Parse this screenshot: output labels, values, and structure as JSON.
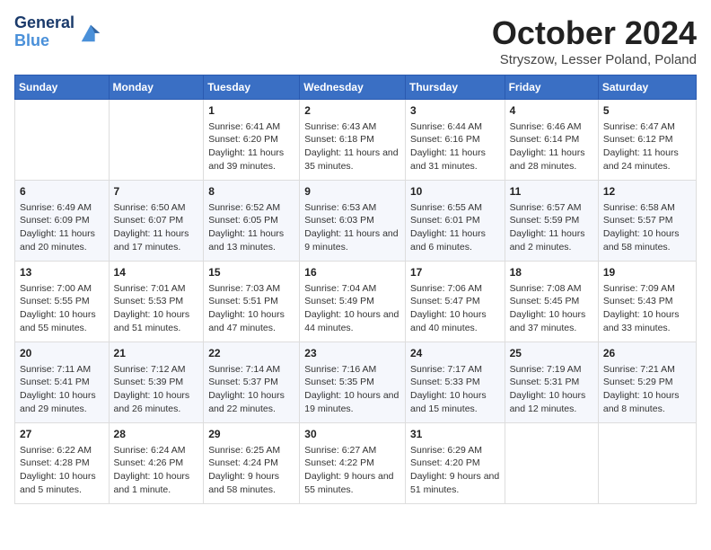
{
  "header": {
    "logo_line1": "General",
    "logo_line2": "Blue",
    "month_title": "October 2024",
    "location": "Stryszow, Lesser Poland, Poland"
  },
  "days_of_week": [
    "Sunday",
    "Monday",
    "Tuesday",
    "Wednesday",
    "Thursday",
    "Friday",
    "Saturday"
  ],
  "weeks": [
    [
      {
        "day": null,
        "info": null
      },
      {
        "day": null,
        "info": null
      },
      {
        "day": "1",
        "info": "Sunrise: 6:41 AM\nSunset: 6:20 PM\nDaylight: 11 hours and 39 minutes."
      },
      {
        "day": "2",
        "info": "Sunrise: 6:43 AM\nSunset: 6:18 PM\nDaylight: 11 hours and 35 minutes."
      },
      {
        "day": "3",
        "info": "Sunrise: 6:44 AM\nSunset: 6:16 PM\nDaylight: 11 hours and 31 minutes."
      },
      {
        "day": "4",
        "info": "Sunrise: 6:46 AM\nSunset: 6:14 PM\nDaylight: 11 hours and 28 minutes."
      },
      {
        "day": "5",
        "info": "Sunrise: 6:47 AM\nSunset: 6:12 PM\nDaylight: 11 hours and 24 minutes."
      }
    ],
    [
      {
        "day": "6",
        "info": "Sunrise: 6:49 AM\nSunset: 6:09 PM\nDaylight: 11 hours and 20 minutes."
      },
      {
        "day": "7",
        "info": "Sunrise: 6:50 AM\nSunset: 6:07 PM\nDaylight: 11 hours and 17 minutes."
      },
      {
        "day": "8",
        "info": "Sunrise: 6:52 AM\nSunset: 6:05 PM\nDaylight: 11 hours and 13 minutes."
      },
      {
        "day": "9",
        "info": "Sunrise: 6:53 AM\nSunset: 6:03 PM\nDaylight: 11 hours and 9 minutes."
      },
      {
        "day": "10",
        "info": "Sunrise: 6:55 AM\nSunset: 6:01 PM\nDaylight: 11 hours and 6 minutes."
      },
      {
        "day": "11",
        "info": "Sunrise: 6:57 AM\nSunset: 5:59 PM\nDaylight: 11 hours and 2 minutes."
      },
      {
        "day": "12",
        "info": "Sunrise: 6:58 AM\nSunset: 5:57 PM\nDaylight: 10 hours and 58 minutes."
      }
    ],
    [
      {
        "day": "13",
        "info": "Sunrise: 7:00 AM\nSunset: 5:55 PM\nDaylight: 10 hours and 55 minutes."
      },
      {
        "day": "14",
        "info": "Sunrise: 7:01 AM\nSunset: 5:53 PM\nDaylight: 10 hours and 51 minutes."
      },
      {
        "day": "15",
        "info": "Sunrise: 7:03 AM\nSunset: 5:51 PM\nDaylight: 10 hours and 47 minutes."
      },
      {
        "day": "16",
        "info": "Sunrise: 7:04 AM\nSunset: 5:49 PM\nDaylight: 10 hours and 44 minutes."
      },
      {
        "day": "17",
        "info": "Sunrise: 7:06 AM\nSunset: 5:47 PM\nDaylight: 10 hours and 40 minutes."
      },
      {
        "day": "18",
        "info": "Sunrise: 7:08 AM\nSunset: 5:45 PM\nDaylight: 10 hours and 37 minutes."
      },
      {
        "day": "19",
        "info": "Sunrise: 7:09 AM\nSunset: 5:43 PM\nDaylight: 10 hours and 33 minutes."
      }
    ],
    [
      {
        "day": "20",
        "info": "Sunrise: 7:11 AM\nSunset: 5:41 PM\nDaylight: 10 hours and 29 minutes."
      },
      {
        "day": "21",
        "info": "Sunrise: 7:12 AM\nSunset: 5:39 PM\nDaylight: 10 hours and 26 minutes."
      },
      {
        "day": "22",
        "info": "Sunrise: 7:14 AM\nSunset: 5:37 PM\nDaylight: 10 hours and 22 minutes."
      },
      {
        "day": "23",
        "info": "Sunrise: 7:16 AM\nSunset: 5:35 PM\nDaylight: 10 hours and 19 minutes."
      },
      {
        "day": "24",
        "info": "Sunrise: 7:17 AM\nSunset: 5:33 PM\nDaylight: 10 hours and 15 minutes."
      },
      {
        "day": "25",
        "info": "Sunrise: 7:19 AM\nSunset: 5:31 PM\nDaylight: 10 hours and 12 minutes."
      },
      {
        "day": "26",
        "info": "Sunrise: 7:21 AM\nSunset: 5:29 PM\nDaylight: 10 hours and 8 minutes."
      }
    ],
    [
      {
        "day": "27",
        "info": "Sunrise: 6:22 AM\nSunset: 4:28 PM\nDaylight: 10 hours and 5 minutes."
      },
      {
        "day": "28",
        "info": "Sunrise: 6:24 AM\nSunset: 4:26 PM\nDaylight: 10 hours and 1 minute."
      },
      {
        "day": "29",
        "info": "Sunrise: 6:25 AM\nSunset: 4:24 PM\nDaylight: 9 hours and 58 minutes."
      },
      {
        "day": "30",
        "info": "Sunrise: 6:27 AM\nSunset: 4:22 PM\nDaylight: 9 hours and 55 minutes."
      },
      {
        "day": "31",
        "info": "Sunrise: 6:29 AM\nSunset: 4:20 PM\nDaylight: 9 hours and 51 minutes."
      },
      {
        "day": null,
        "info": null
      },
      {
        "day": null,
        "info": null
      }
    ]
  ]
}
